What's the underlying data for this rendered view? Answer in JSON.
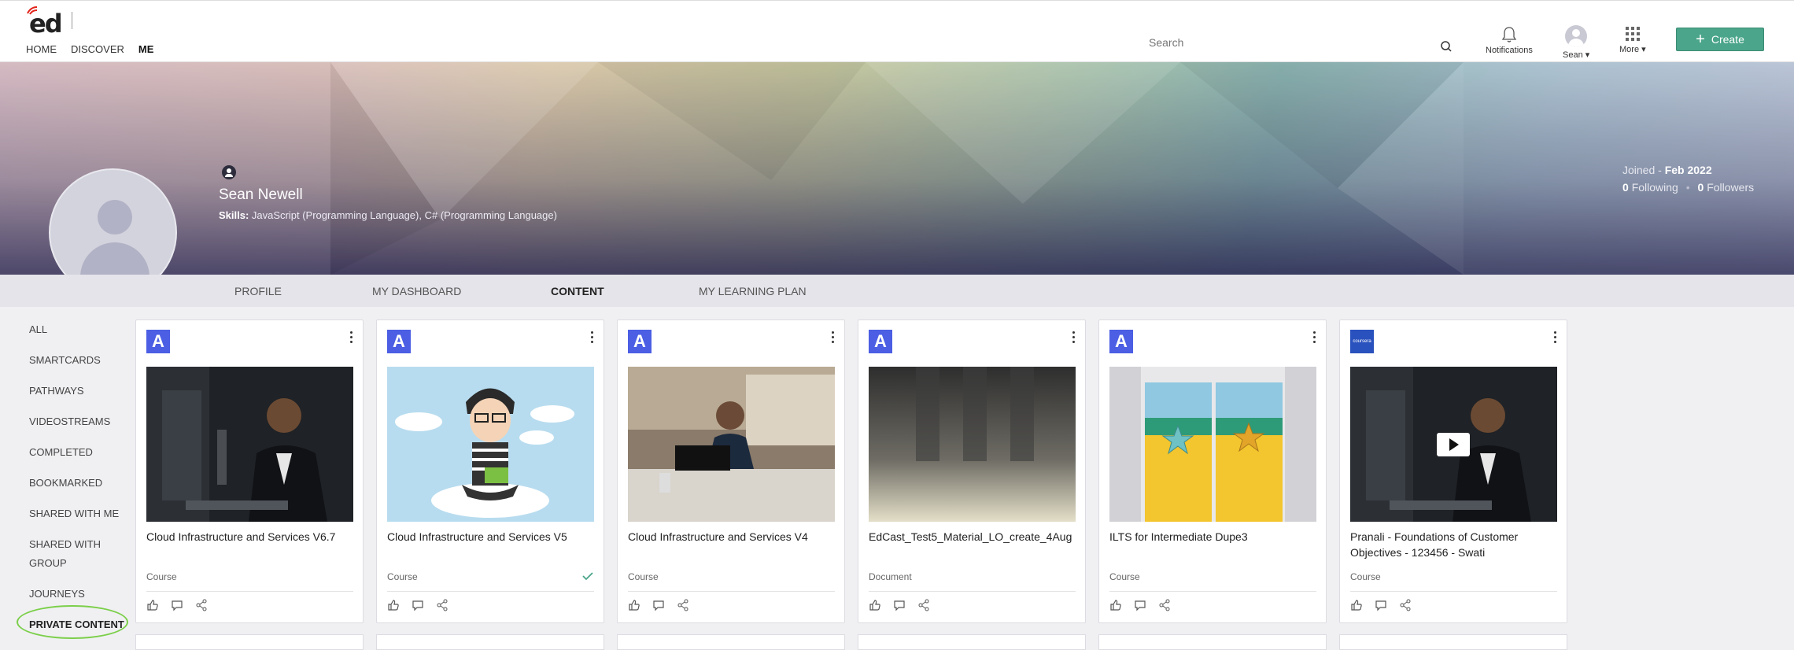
{
  "header": {
    "logo_text": "ed",
    "nav": [
      "HOME",
      "DISCOVER",
      "ME"
    ],
    "search_placeholder": "Search",
    "notifications_label": "Notifications",
    "user_label": "Sean ▾",
    "more_label": "More ▾",
    "create_label": "Create"
  },
  "profile": {
    "name": "Sean Newell",
    "skills_label": "Skills:",
    "skills": "JavaScript (Programming Language), C# (Programming Language)",
    "joined_label": "Joined -",
    "joined_value": "Feb 2022",
    "following_count": "0",
    "following_label": "Following",
    "followers_count": "0",
    "followers_label": "Followers"
  },
  "tabs": [
    "PROFILE",
    "MY DASHBOARD",
    "CONTENT",
    "MY LEARNING PLAN"
  ],
  "active_tab": "CONTENT",
  "sidebar": [
    "ALL",
    "SMARTCARDS",
    "PATHWAYS",
    "VIDEOSTREAMS",
    "COMPLETED",
    "BOOKMARKED",
    "SHARED WITH ME",
    "SHARED WITH",
    "GROUP",
    "JOURNEYS",
    "PRIVATE CONTENT"
  ],
  "cards": [
    {
      "badge": "A",
      "title": "Cloud Infrastructure and Services V6.7",
      "type": "Course",
      "completed": false
    },
    {
      "badge": "A",
      "title": "Cloud Infrastructure and Services V5",
      "type": "Course",
      "completed": true
    },
    {
      "badge": "A",
      "title": "Cloud Infrastructure and Services V4",
      "type": "Course",
      "completed": false
    },
    {
      "badge": "A",
      "title": "EdCast_Test5_Material_LO_create_4Aug",
      "type": "Document",
      "completed": false
    },
    {
      "badge": "A",
      "title": "ILTS for Intermediate Dupe3",
      "type": "Course",
      "completed": false
    },
    {
      "badge": "coursera",
      "title": "Pranali - Foundations of Customer Objectives - 123456 - Swati",
      "type": "Course",
      "completed": false
    }
  ],
  "colors": {
    "create_button": "#4aa58a",
    "badge": "#4b5ee4",
    "highlight_circle": "#7ccf4a"
  }
}
